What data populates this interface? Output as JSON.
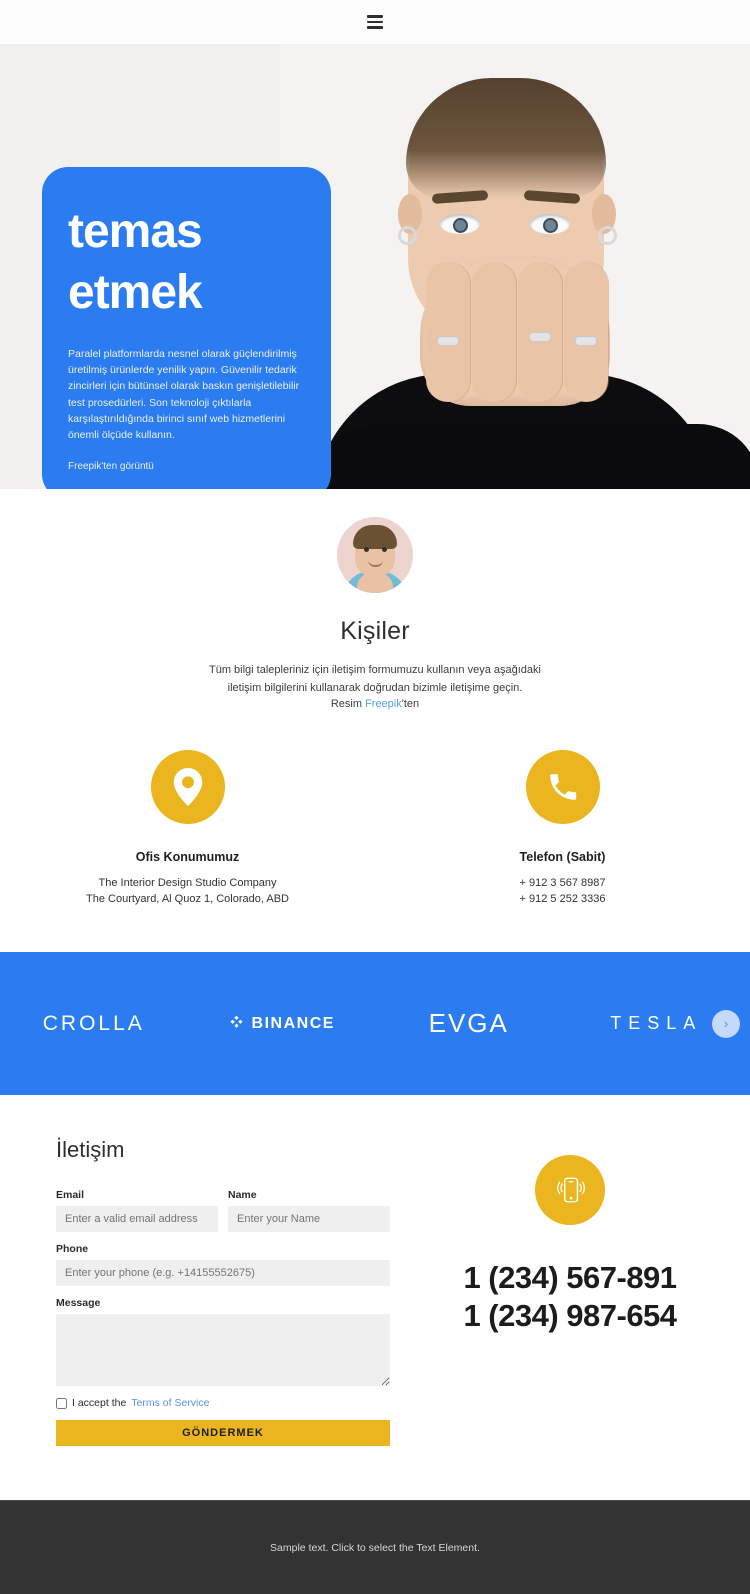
{
  "header": {
    "menu_icon": "hamburger-menu-icon"
  },
  "hero": {
    "title_line1": "temas",
    "title_line2": "etmek",
    "description": "Paralel platformlarda nesnel olarak güçlendirilmiş üretilmiş ürünlerde yenilik yapın. Güvenilir tedarik zincirleri için bütünsel olarak baskın genişletilebilir test prosedürleri. Son teknoloji çıktılarla karşılaştırıldığında birinci sınıf web hizmetlerini önemli ölçüde kullanın.",
    "credit": "Freepik'ten görüntü",
    "card_color": "#2b7cf0",
    "background_color": "#f2f1ef"
  },
  "contacts": {
    "avatar_name": "portrait-avatar",
    "heading": "Kişiler",
    "lede": "Tüm bilgi talepleriniz için iletişim formumuzu kullanın veya aşağıdaki iletişim bilgilerini kullanarak doğrudan bizimle iletişime geçin.",
    "credit_prefix": "Resim ",
    "credit_link": "Freepik",
    "credit_suffix": "'ten",
    "cards": [
      {
        "icon": "location-pin-icon",
        "title": "Ofis Konumumuz",
        "line1": "The Interior Design Studio Company",
        "line2": "The Courtyard, Al Quoz 1, Colorado,  ABD"
      },
      {
        "icon": "phone-handset-icon",
        "title": "Telefon (Sabit)",
        "line1": "+ 912 3 567 8987",
        "line2": "+ 912 5 252 3336"
      }
    ]
  },
  "logos": {
    "background_color": "#2b7cf0",
    "items": [
      {
        "name": "CROLLA",
        "icon": ""
      },
      {
        "name": "BINANCE",
        "icon": "binance-diamond-icon"
      },
      {
        "name": "EVGA",
        "icon": ""
      },
      {
        "name": "TESLA",
        "icon": ""
      }
    ],
    "next_arrow": "›"
  },
  "form": {
    "title": "İletişim",
    "email_label": "Email",
    "email_placeholder": "Enter a valid email address",
    "email_value": "",
    "name_label": "Name",
    "name_placeholder": "Enter your Name",
    "name_value": "",
    "phone_label": "Phone",
    "phone_placeholder": "Enter your phone (e.g. +14155552675)",
    "phone_value": "",
    "message_label": "Message",
    "message_placeholder": "",
    "message_value": "",
    "accept_text": "I accept the ",
    "terms_link": "Terms of Service",
    "submit_label": "GÖNDERMEK",
    "accent_color": "#eab51e"
  },
  "contact_right": {
    "icon": "mobile-ringing-icon",
    "phone1": "1 (234) 567-891",
    "phone2": "1 (234) 987-654"
  },
  "footer": {
    "text": "Sample text. Click to select the Text Element.",
    "background_color": "#333333"
  }
}
